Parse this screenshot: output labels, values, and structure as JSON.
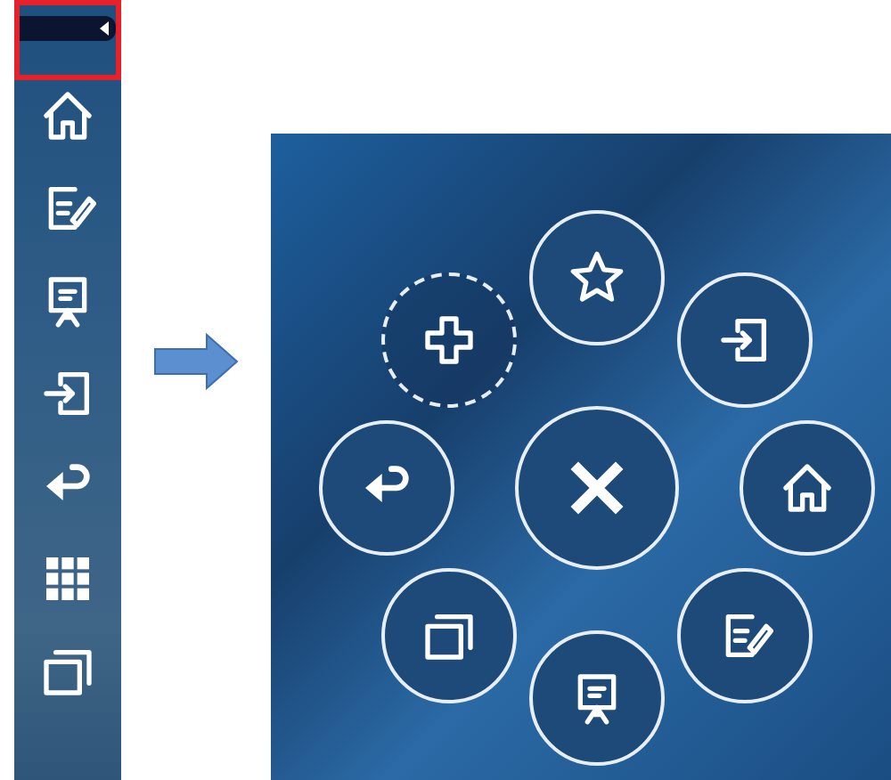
{
  "sidebar": {
    "highlighted": true,
    "items": [
      {
        "kind": "home"
      },
      {
        "kind": "edit"
      },
      {
        "kind": "easel"
      },
      {
        "kind": "input"
      },
      {
        "kind": "return"
      },
      {
        "kind": "grid"
      },
      {
        "kind": "windows"
      }
    ]
  },
  "radial_menu": {
    "center": {
      "kind": "close"
    },
    "buttons": [
      {
        "kind": "star",
        "dashed": false
      },
      {
        "kind": "input",
        "dashed": false
      },
      {
        "kind": "home",
        "dashed": false
      },
      {
        "kind": "edit",
        "dashed": false
      },
      {
        "kind": "easel",
        "dashed": false
      },
      {
        "kind": "windows",
        "dashed": false
      },
      {
        "kind": "return",
        "dashed": false
      },
      {
        "kind": "plus",
        "dashed": true
      }
    ]
  }
}
